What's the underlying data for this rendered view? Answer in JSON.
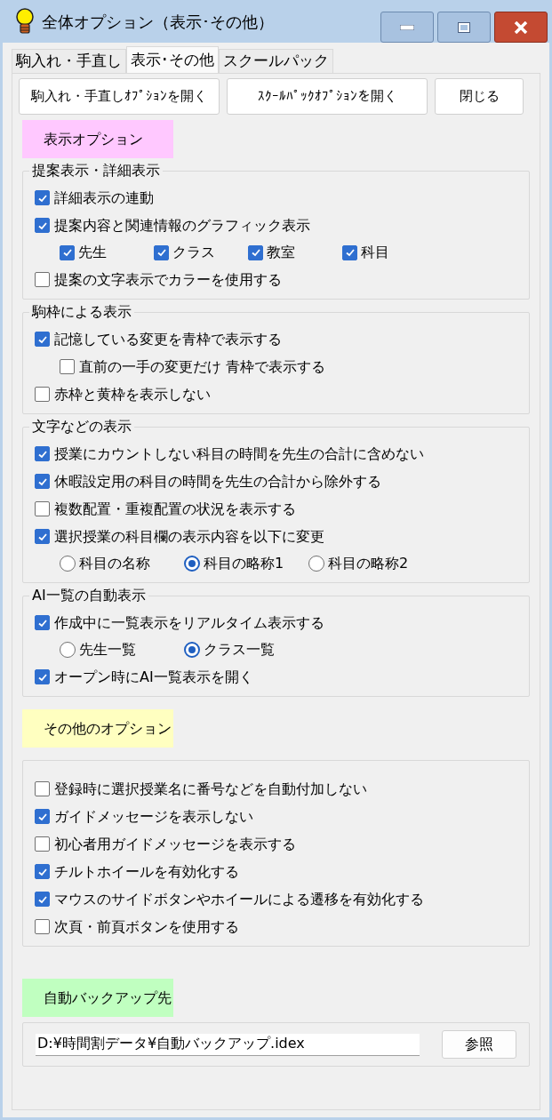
{
  "window": {
    "title": "全体オプション（表示･その他）"
  },
  "tabs": [
    {
      "label": "駒入れ・手直し",
      "selected": false
    },
    {
      "label": "表示･その他",
      "selected": true
    },
    {
      "label": "スクールパック",
      "selected": false
    }
  ],
  "buttons": [
    "駒入れ・手直しｵﾌﾟｼｮﾝを開く",
    "ｽｸｰﾙﾊﾟｯｸｵﾌﾟｼｮﾝを開く",
    "閉じる"
  ],
  "sections": [
    {
      "kind": "header",
      "label": "表示オプション",
      "color": "#ffc8ff"
    },
    {
      "kind": "group",
      "title": "提案表示・詳細表示",
      "rows": [
        {
          "kind": "check",
          "label": "詳細表示の連動",
          "checked": true
        },
        {
          "kind": "check",
          "label": "提案内容と関連情報のグラフィック表示",
          "checked": true,
          "children": [
            {
              "kind": "checks",
              "items": [
                {
                  "label": "先生",
                  "checked": true
                },
                {
                  "label": "クラス",
                  "checked": true
                },
                {
                  "label": "教室",
                  "checked": true
                },
                {
                  "label": "科目",
                  "checked": true
                }
              ]
            }
          ]
        },
        {
          "kind": "check",
          "label": "提案の文字表示でカラーを使用する",
          "checked": false
        }
      ]
    },
    {
      "kind": "group",
      "title": "駒枠による表示",
      "rows": [
        {
          "kind": "check",
          "label": "記憶している変更を青枠で表示する",
          "checked": true,
          "children": [
            {
              "kind": "check",
              "label": "直前の一手の変更だけ 青枠で表示する",
              "checked": false
            }
          ]
        },
        {
          "kind": "check",
          "label": "赤枠と黄枠を表示しない",
          "checked": false
        }
      ]
    },
    {
      "kind": "group",
      "title": "文字などの表示",
      "rows": [
        {
          "kind": "check",
          "label": "授業にカウントしない科目の時間を先生の合計に含めない",
          "checked": true
        },
        {
          "kind": "check",
          "label": "休暇設定用の科目の時間を先生の合計から除外する",
          "checked": true
        },
        {
          "kind": "check",
          "label": "複数配置・重複配置の状況を表示する",
          "checked": false
        },
        {
          "kind": "check",
          "label": "選択授業の科目欄の表示内容を以下に変更",
          "checked": true,
          "children": [
            {
              "kind": "radios",
              "items": [
                {
                  "label": "科目の名称",
                  "selected": false
                },
                {
                  "label": "科目の略称1",
                  "selected": true
                },
                {
                  "label": "科目の略称2",
                  "selected": false
                }
              ]
            }
          ]
        }
      ]
    },
    {
      "kind": "group",
      "title": "AI一覧の自動表示",
      "rows": [
        {
          "kind": "check",
          "label": "作成中に一覧表示をリアルタイム表示する",
          "checked": true,
          "children": [
            {
              "kind": "radios",
              "items": [
                {
                  "label": "先生一覧",
                  "selected": false
                },
                {
                  "label": "クラス一覧",
                  "selected": true
                }
              ]
            }
          ]
        },
        {
          "kind": "check",
          "label": "オープン時にAI一覧表示を開く",
          "checked": true
        }
      ]
    },
    {
      "kind": "header",
      "label": "その他のオプション",
      "color": "#ffffc0"
    },
    {
      "kind": "group",
      "rows": [
        {
          "kind": "check",
          "label": "登録時に選択授業名に番号などを自動付加しない",
          "checked": false
        },
        {
          "kind": "check",
          "label": "ガイドメッセージを表示しない",
          "checked": true
        },
        {
          "kind": "check",
          "label": "初心者用ガイドメッセージを表示する",
          "checked": false
        },
        {
          "kind": "check",
          "label": "チルトホイールを有効化する",
          "checked": true
        },
        {
          "kind": "check",
          "label": "マウスのサイドボタンやホイールによる遷移を有効化する",
          "checked": true
        },
        {
          "kind": "check",
          "label": "次頁・前頁ボタンを使用する",
          "checked": false
        }
      ]
    },
    {
      "kind": "header",
      "label": "自動バックアップ先",
      "color": "#c0ffc0"
    },
    {
      "kind": "path",
      "value": "D:¥時間割データ¥自動バックアップ.idex",
      "button": "参照"
    }
  ]
}
